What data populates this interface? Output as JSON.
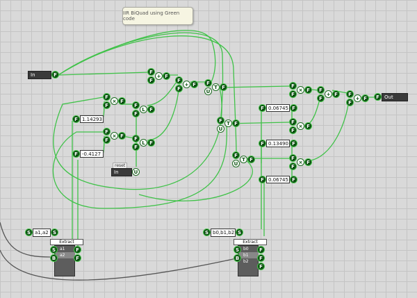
{
  "comment": "IIR BiQuad using Green code",
  "input_label": "In",
  "output_label": "Out",
  "reset_small": "reset",
  "reset_label": "In",
  "coeffs": {
    "a1": "1.14293",
    "a2": "-0.4127",
    "b0": "0.06745",
    "b1": "0.13490",
    "b2": "0.06745"
  },
  "list_a": "a1,a2",
  "list_b": "b0,b1,b2",
  "extract_title": "Extract",
  "extract_a_rows": [
    "a1",
    "a2"
  ],
  "extract_b_rows": [
    "b0",
    "b1",
    "b2"
  ],
  "glyphs": {
    "float": "F",
    "string": "S",
    "bang": "B",
    "mul": "×",
    "add": "+",
    "delay": "L",
    "trig": "T",
    "cast": "U"
  },
  "colors": {
    "wire_green": "#3fc248",
    "wire_dark": "#555555",
    "node_green": "#0b4f10"
  }
}
